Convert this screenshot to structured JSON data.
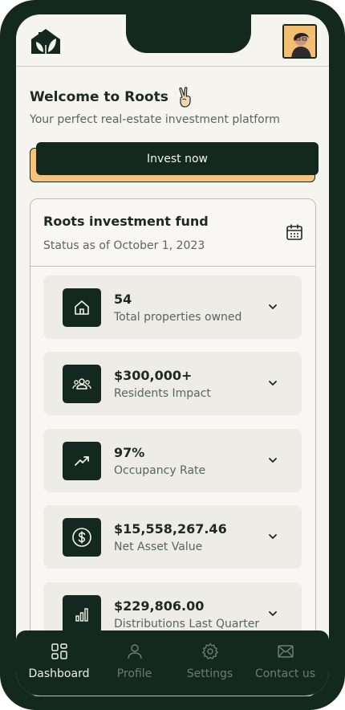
{
  "header": {
    "logo_icon": "roots-house-leaf-logo",
    "avatar": "user-avatar"
  },
  "welcome": {
    "title": "Welcome to Roots",
    "emoji_icon": "victory-hand-icon",
    "subtitle": "Your perfect real-estate investment  platform"
  },
  "cta": {
    "label": "Invest now"
  },
  "fund": {
    "title": "Roots investment  fund",
    "status": "Status as of October 1, 2023",
    "calendar_icon": "calendar-icon",
    "metrics": [
      {
        "value": "54",
        "label": "Total properties owned",
        "icon": "home-icon"
      },
      {
        "value": "$300,000+",
        "label": "Residents Impact",
        "icon": "users-icon"
      },
      {
        "value": "97%",
        "label": "Occupancy Rate",
        "icon": "trending-up-icon"
      },
      {
        "value": "$15,558,267.46",
        "label": "Net Asset Value",
        "icon": "dollar-circle-icon"
      },
      {
        "value": "$229,806.00",
        "label": "Distributions Last Quarter",
        "icon": "bar-chart-icon"
      }
    ]
  },
  "nav": {
    "items": [
      {
        "label": "Dashboard",
        "icon": "dashboard-grid-icon",
        "active": true
      },
      {
        "label": "Profile",
        "icon": "user-icon",
        "active": false
      },
      {
        "label": "Settings",
        "icon": "gear-icon",
        "active": false
      },
      {
        "label": "Contact us",
        "icon": "mail-icon",
        "active": false
      }
    ]
  },
  "colors": {
    "dark": "#13281f",
    "accent": "#f4c47c",
    "background": "#f6f4ee",
    "card": "#eeece6"
  }
}
